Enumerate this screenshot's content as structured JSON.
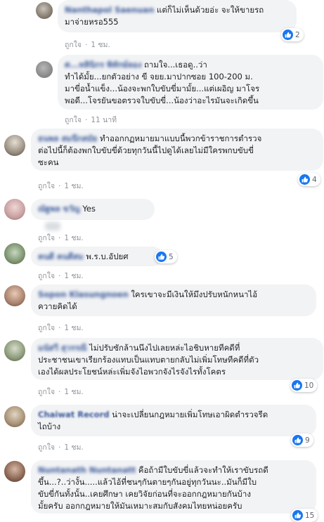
{
  "comments": [
    {
      "author": "Nanthapol Saenuan",
      "lines": [
        "แต่ก็ไม่เห็นด้วยอ่ะ จะให้ขายรถ",
        "มาจ่ายหรอ555"
      ],
      "like_label": "ถูกใจ",
      "time": "1 ชม.",
      "reactions": "2"
    },
    {
      "author": "ศ...ทลินิกร พิทักษ์ลอง",
      "lines": [
        "ถามใจ...เธอดู..ว่า",
        "ทำได้มั้ย...ยกตัวอย่าง ขี จยย.มาปากซอย 100-200 ม.",
        "มาขี่อนํ้าแข็ง...น้องจะพกใบขับขี่มามั้ย...แต่เผอิญ มาโจร",
        "พอดี...โจรยันขอตรวจใบขับขี่...น้องว่าอะไรมันจะเกิดขึ้น"
      ],
      "like_label": "ถูกใจ",
      "time": "11 นาที"
    },
    {
      "author": "ธนพล สมนึกสมัย",
      "lines": [
        "ทำออกกฏหมายมาแบบนี้พวกข้าราชการตำรวจ",
        "ต่อไปนี้ก็ต้องพกใบขับขี่ด้วยทุกวันนี้ไปดูได้เลยไม่มีใครพกบขับขี่",
        "ซะคน"
      ],
      "like_label": "ถูกใจ",
      "time": "1 ชม.",
      "reactions": "4"
    },
    {
      "author": "ณัฐพล ขวัญ",
      "lines": [
        "Yes"
      ],
      "like_label": "ถูกใจ",
      "time": "1 ชม."
    },
    {
      "author": "คนดี คนดีสม",
      "lines": [
        "พ.ร.บ.อัปยศ"
      ],
      "like_label": "ถูกใจ",
      "time": "1 ชม.",
      "reactions": "5"
    },
    {
      "author": "Sopon Klasungnoen",
      "lines": [
        "ใครเขาจะมีเงินให้มึงปรับหนักหนาไอ้",
        "ควายคิดได้"
      ],
      "like_label": "ถูกใจ",
      "time": "1 ชม."
    },
    {
      "author": "มนัสวี สุวรรณี",
      "lines": [
        "ไม่ปรับซักล้านนึงไปเลยหล่ะไอชิบหายทีคดีที่",
        "ประชาชนเขาเรียกร้องแทบเป็นแทบตายกลับไม่เพิ่มโทษทีคดีที่ตัว",
        "เองได้ผลประโยชน์หล่ะเพิ่มจังไอพวกจังไรจังไรทั้งโคตร"
      ],
      "like_label": "ถูกใจ",
      "time": "1 ชม.",
      "reactions": "10"
    },
    {
      "author": "Chaiwat Record",
      "lines": [
        "น่าจะเปลี่ยนกฎหมายเพิ่มโทษเอาผิดตำรวจรีด",
        "ไถบ้าง"
      ],
      "like_label": "ถูกใจ",
      "time": "1 ชม.",
      "reactions": "9"
    },
    {
      "author": "Nuntanath Nuntanatt",
      "lines": [
        "คือถ้ามีใบขับขี่แล้วจะทำให้เราขับรถดี",
        "ขึ้น...?..ว่างั้น.....แล้วไอ้ที่ชนๆกันตายๆกันอยู่ทุกวันนะ..มันก็มีใบ",
        "ขับขี่กันทั้งนั้น..เคยศึกษา เคยวิจัยก่อนที่จะออกกฎหมายกันบ้าง",
        "มั้ยครับ ออกกฎหมายให้มันเหมาะสมกับสังคมไทยหน่อยครับ"
      ],
      "like_label": "ถูกใจ",
      "time": "1 ชม.",
      "reactions": "15"
    }
  ]
}
